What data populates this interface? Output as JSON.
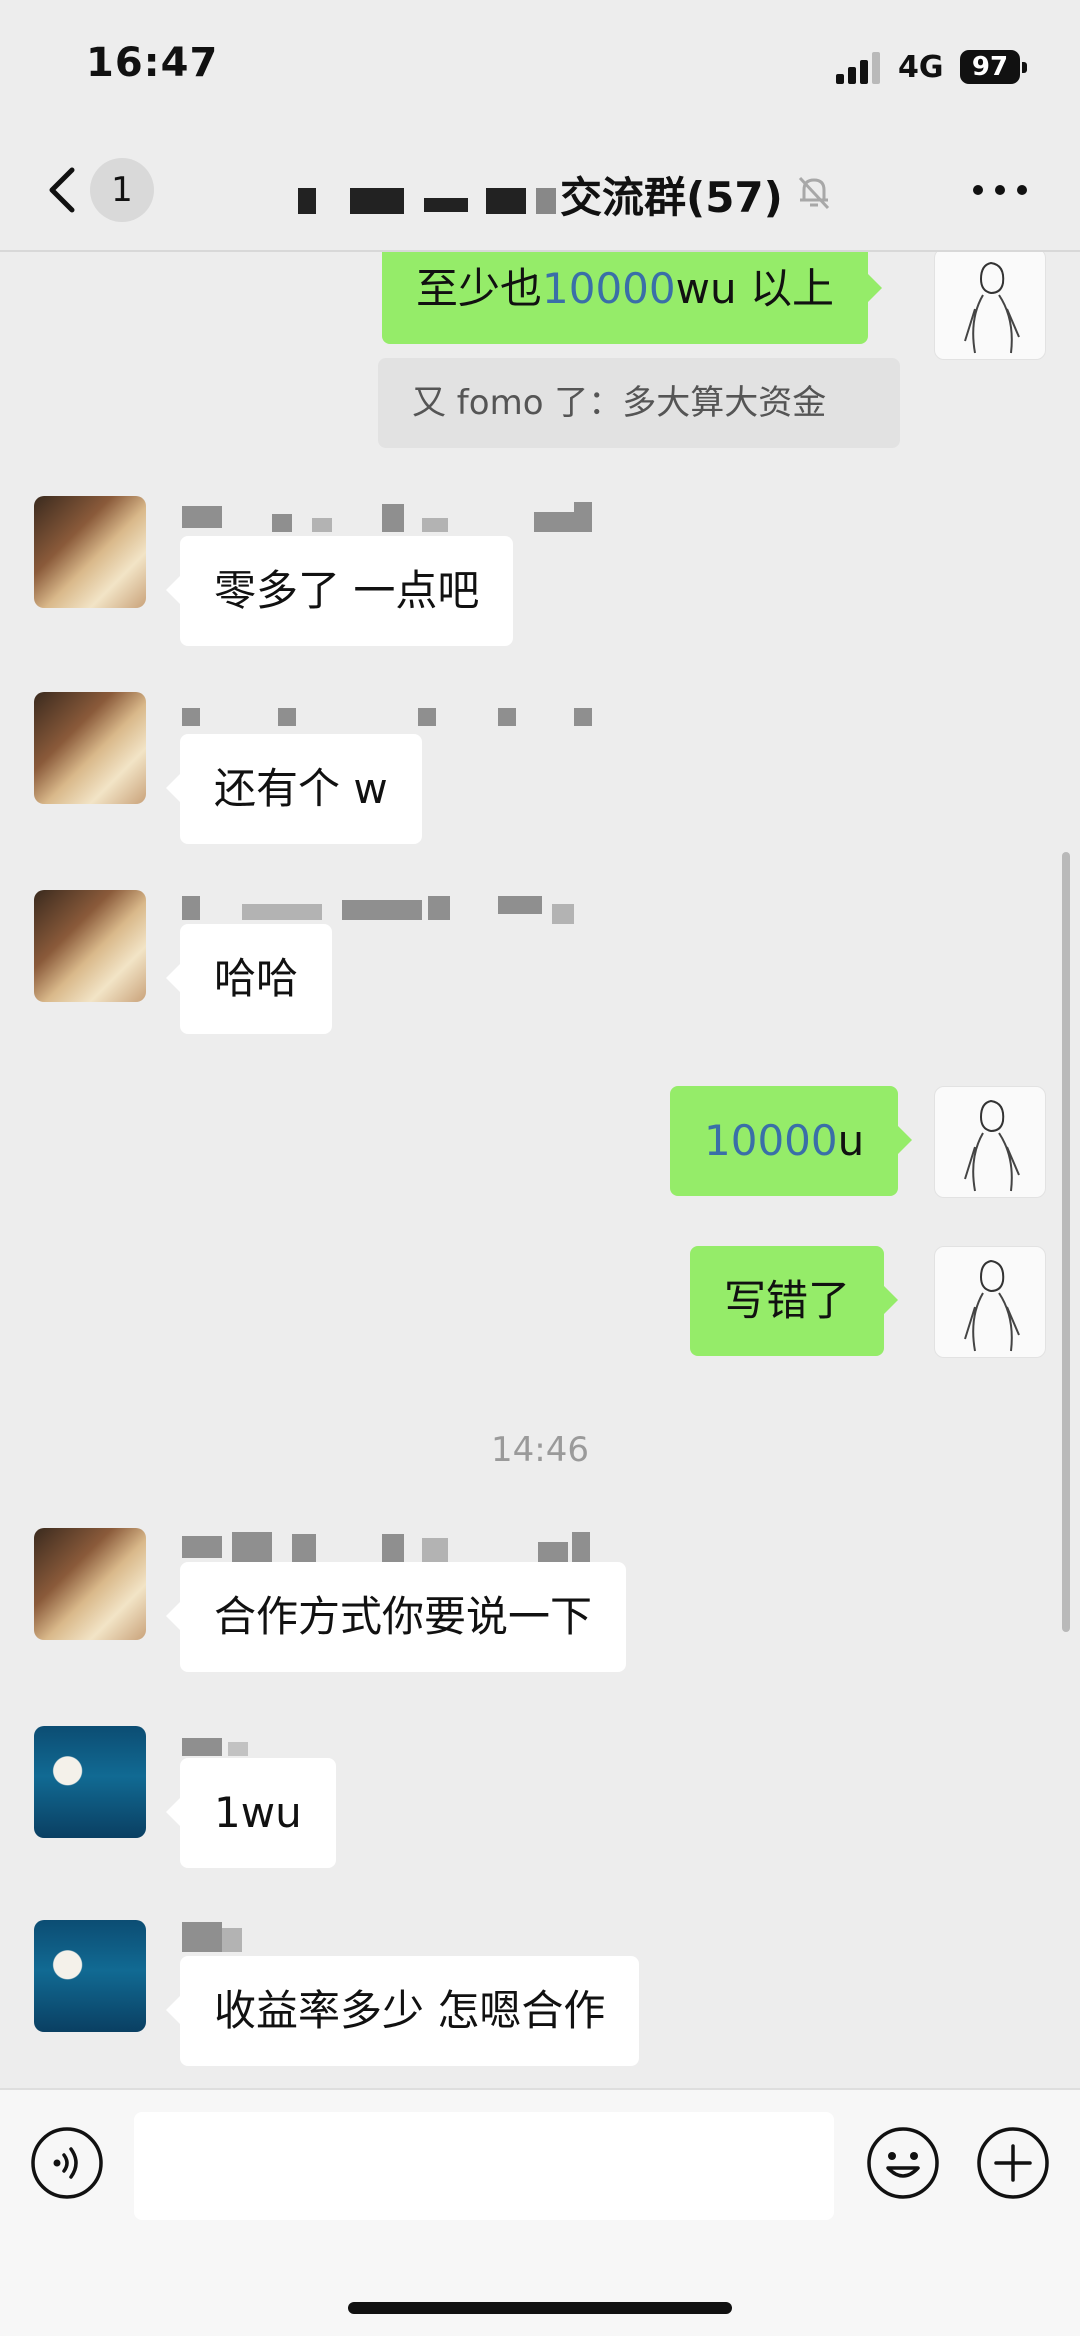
{
  "status_bar": {
    "time": "16:47",
    "network": "4G",
    "battery": "97"
  },
  "header": {
    "back_badge": "1",
    "title_visible": "交流群",
    "member_count": "(57)"
  },
  "messages": [
    {
      "side": "out",
      "parts": [
        "至少也",
        "10000",
        "wu 以上"
      ],
      "quote": "又 fomo 了：多大算大资金"
    },
    {
      "side": "in",
      "text": "零多了 一点吧"
    },
    {
      "side": "in",
      "text": "还有个 w"
    },
    {
      "side": "in",
      "text": "哈哈"
    },
    {
      "side": "out",
      "parts": [
        "",
        "10000",
        "u"
      ]
    },
    {
      "side": "out",
      "text": "写错了"
    },
    {
      "type": "timestamp",
      "text": "14:46"
    },
    {
      "side": "in",
      "text": "合作方式你要说一下"
    },
    {
      "side": "in",
      "text": "1wu"
    },
    {
      "side": "in",
      "text": "收益率多少 怎嗯合作"
    }
  ],
  "input_bar": {
    "placeholder": ""
  },
  "icons": [
    "back-chevron-icon",
    "mute-bell-icon",
    "more-icon",
    "voice-icon",
    "emoji-icon",
    "plus-icon"
  ],
  "colors": {
    "outgoing_bubble": "#95ec69",
    "incoming_bubble": "#ffffff",
    "background": "#ededed",
    "number_link": "#3a6fa8"
  }
}
